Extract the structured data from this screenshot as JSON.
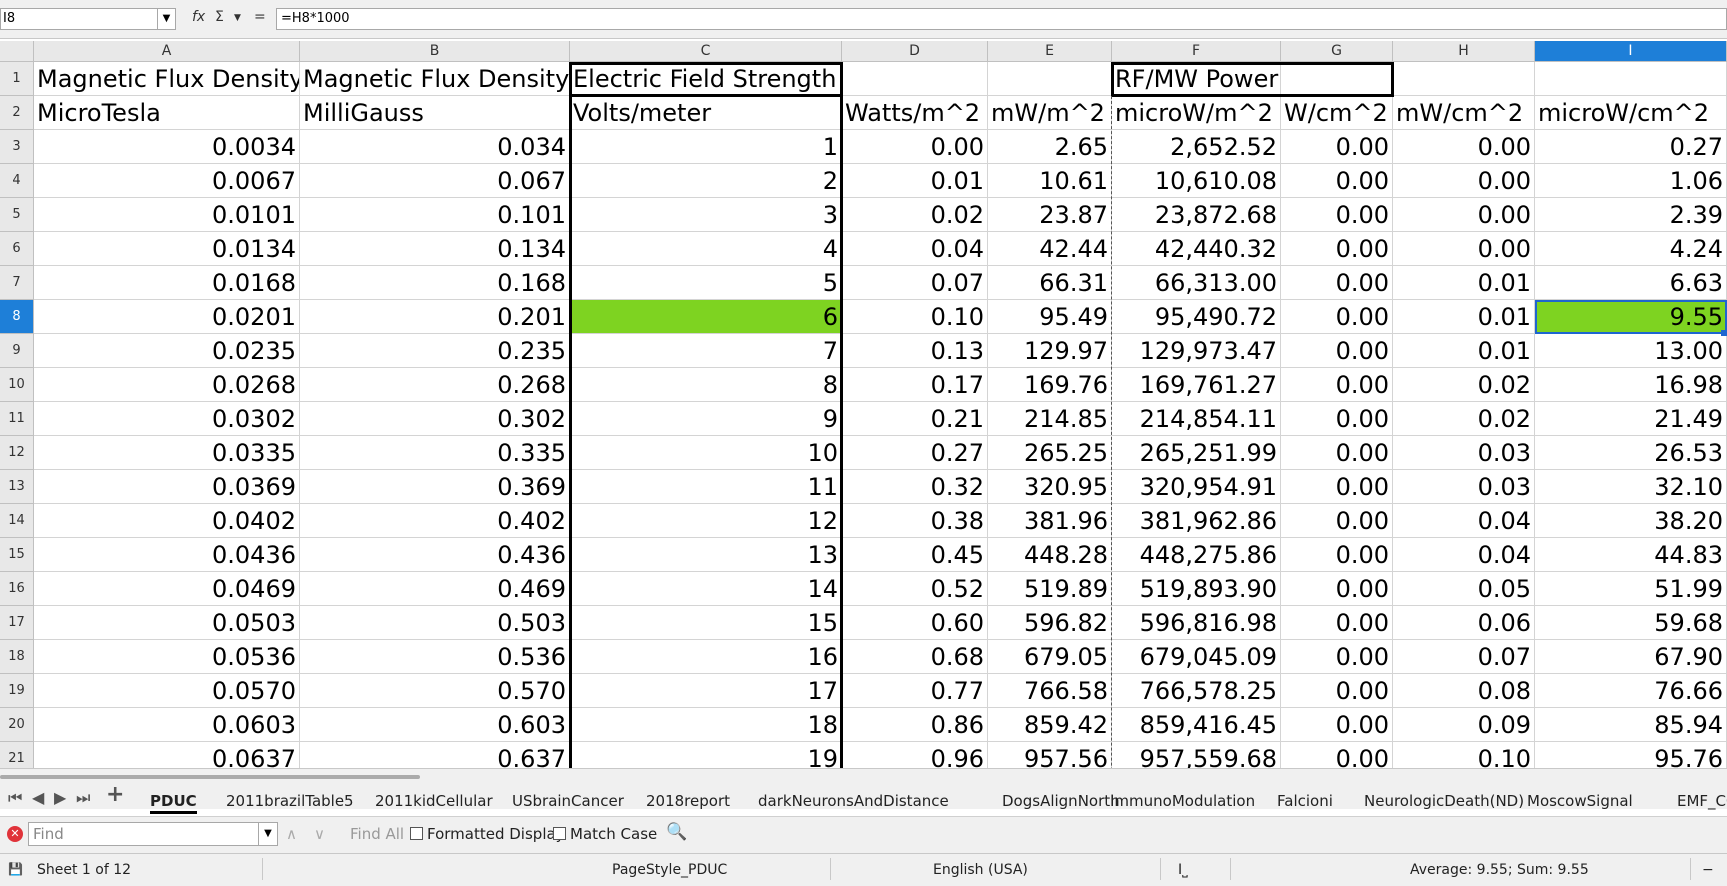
{
  "formula_bar": {
    "name_box": "I8",
    "function_icon": "fx",
    "sum_icon": "Σ",
    "equals": "=",
    "formula": "=H8*1000"
  },
  "columns": [
    "A",
    "B",
    "C",
    "D",
    "E",
    "F",
    "G",
    "H",
    "I"
  ],
  "selected_column": "I",
  "rows": [
    {
      "n": "1",
      "cells": [
        "Magnetic Flux Density",
        "Magnetic Flux Density",
        "Electric Field Strength",
        "",
        "",
        "RF/MW PowerDensity",
        "",
        "",
        ""
      ]
    },
    {
      "n": "2",
      "cells": [
        "MicroTesla",
        "MilliGauss",
        "Volts/meter",
        "Watts/m^2",
        "mW/m^2",
        "microW/m^2",
        "W/cm^2",
        "mW/cm^2",
        "microW/cm^2"
      ]
    },
    {
      "n": "3",
      "cells": [
        "0.0034",
        "0.034",
        "1",
        "0.00",
        "2.65",
        "2,652.52",
        "0.00",
        "0.00",
        "0.27"
      ]
    },
    {
      "n": "4",
      "cells": [
        "0.0067",
        "0.067",
        "2",
        "0.01",
        "10.61",
        "10,610.08",
        "0.00",
        "0.00",
        "1.06"
      ]
    },
    {
      "n": "5",
      "cells": [
        "0.0101",
        "0.101",
        "3",
        "0.02",
        "23.87",
        "23,872.68",
        "0.00",
        "0.00",
        "2.39"
      ]
    },
    {
      "n": "6",
      "cells": [
        "0.0134",
        "0.134",
        "4",
        "0.04",
        "42.44",
        "42,440.32",
        "0.00",
        "0.00",
        "4.24"
      ]
    },
    {
      "n": "7",
      "cells": [
        "0.0168",
        "0.168",
        "5",
        "0.07",
        "66.31",
        "66,313.00",
        "0.00",
        "0.01",
        "6.63"
      ]
    },
    {
      "n": "8",
      "cells": [
        "0.0201",
        "0.201",
        "6",
        "0.10",
        "95.49",
        "95,490.72",
        "0.00",
        "0.01",
        "9.55"
      ]
    },
    {
      "n": "9",
      "cells": [
        "0.0235",
        "0.235",
        "7",
        "0.13",
        "129.97",
        "129,973.47",
        "0.00",
        "0.01",
        "13.00"
      ]
    },
    {
      "n": "10",
      "cells": [
        "0.0268",
        "0.268",
        "8",
        "0.17",
        "169.76",
        "169,761.27",
        "0.00",
        "0.02",
        "16.98"
      ]
    },
    {
      "n": "11",
      "cells": [
        "0.0302",
        "0.302",
        "9",
        "0.21",
        "214.85",
        "214,854.11",
        "0.00",
        "0.02",
        "21.49"
      ]
    },
    {
      "n": "12",
      "cells": [
        "0.0335",
        "0.335",
        "10",
        "0.27",
        "265.25",
        "265,251.99",
        "0.00",
        "0.03",
        "26.53"
      ]
    },
    {
      "n": "13",
      "cells": [
        "0.0369",
        "0.369",
        "11",
        "0.32",
        "320.95",
        "320,954.91",
        "0.00",
        "0.03",
        "32.10"
      ]
    },
    {
      "n": "14",
      "cells": [
        "0.0402",
        "0.402",
        "12",
        "0.38",
        "381.96",
        "381,962.86",
        "0.00",
        "0.04",
        "38.20"
      ]
    },
    {
      "n": "15",
      "cells": [
        "0.0436",
        "0.436",
        "13",
        "0.45",
        "448.28",
        "448,275.86",
        "0.00",
        "0.04",
        "44.83"
      ]
    },
    {
      "n": "16",
      "cells": [
        "0.0469",
        "0.469",
        "14",
        "0.52",
        "519.89",
        "519,893.90",
        "0.00",
        "0.05",
        "51.99"
      ]
    },
    {
      "n": "17",
      "cells": [
        "0.0503",
        "0.503",
        "15",
        "0.60",
        "596.82",
        "596,816.98",
        "0.00",
        "0.06",
        "59.68"
      ]
    },
    {
      "n": "18",
      "cells": [
        "0.0536",
        "0.536",
        "16",
        "0.68",
        "679.05",
        "679,045.09",
        "0.00",
        "0.07",
        "67.90"
      ]
    },
    {
      "n": "19",
      "cells": [
        "0.0570",
        "0.570",
        "17",
        "0.77",
        "766.58",
        "766,578.25",
        "0.00",
        "0.08",
        "76.66"
      ]
    },
    {
      "n": "20",
      "cells": [
        "0.0603",
        "0.603",
        "18",
        "0.86",
        "859.42",
        "859,416.45",
        "0.00",
        "0.09",
        "85.94"
      ]
    },
    {
      "n": "21",
      "cells": [
        "0.0637",
        "0.637",
        "19",
        "0.96",
        "957.56",
        "957,559.68",
        "0.00",
        "0.10",
        "95.76"
      ]
    }
  ],
  "highlight_color": "#7ed321",
  "selection_color": "#1e7fd8",
  "sheet_tabs": [
    "PDUC",
    "2011brazilTable5",
    "2011kidCellular",
    "USbrainCancer",
    "2018report",
    "darkNeuronsAndDistance",
    "DogsAlignNorth",
    "ImmunoModulation",
    "Falcioni",
    "NeurologicDeath(ND)",
    "MoscowSignal",
    "EMF_CC"
  ],
  "active_tab": "PDUC",
  "find_bar": {
    "placeholder": "Find",
    "find_all": "Find All",
    "formatted_display": "Formatted Display",
    "match_case": "Match Case"
  },
  "status_bar": {
    "sheet": "Sheet 1 of 12",
    "page_style": "PageStyle_PDUC",
    "language": "English (USA)",
    "summary": "Average: 9.55; Sum: 9.55"
  }
}
